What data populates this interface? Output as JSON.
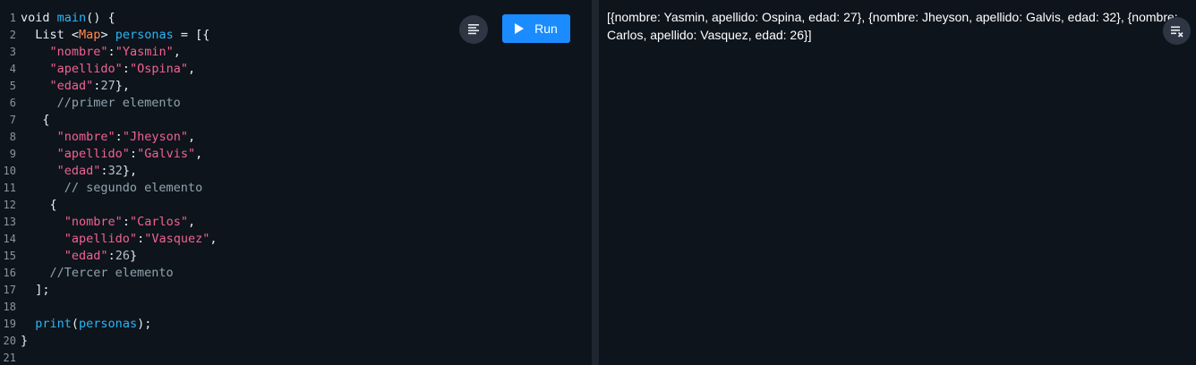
{
  "editor": {
    "line_numbers": [
      "1",
      "2",
      "3",
      "4",
      "5",
      "6",
      "7",
      "8",
      "9",
      "10",
      "11",
      "12",
      "13",
      "14",
      "15",
      "16",
      "17",
      "18",
      "19",
      "20",
      "21"
    ],
    "lines": [
      [
        {
          "t": "void ",
          "c": "kw"
        },
        {
          "t": "main",
          "c": "fn"
        },
        {
          "t": "() {",
          "c": "pl"
        }
      ],
      [
        {
          "t": "  List ",
          "c": "pl"
        },
        {
          "t": "<",
          "c": "pl"
        },
        {
          "t": "Map",
          "c": "ty"
        },
        {
          "t": "> ",
          "c": "pl"
        },
        {
          "t": "personas",
          "c": "fn"
        },
        {
          "t": " = [{",
          "c": "pl"
        }
      ],
      [
        {
          "t": "    ",
          "c": "pl"
        },
        {
          "t": "\"nombre\"",
          "c": "st"
        },
        {
          "t": ":",
          "c": "pl"
        },
        {
          "t": "\"Yasmin\"",
          "c": "st"
        },
        {
          "t": ",",
          "c": "pl"
        }
      ],
      [
        {
          "t": "    ",
          "c": "pl"
        },
        {
          "t": "\"apellido\"",
          "c": "st"
        },
        {
          "t": ":",
          "c": "pl"
        },
        {
          "t": "\"Ospina\"",
          "c": "st"
        },
        {
          "t": ",",
          "c": "pl"
        }
      ],
      [
        {
          "t": "    ",
          "c": "pl"
        },
        {
          "t": "\"edad\"",
          "c": "st"
        },
        {
          "t": ":",
          "c": "pl"
        },
        {
          "t": "27",
          "c": "nm"
        },
        {
          "t": "},",
          "c": "pl"
        }
      ],
      [
        {
          "t": "     //primer elemento",
          "c": "cm"
        }
      ],
      [
        {
          "t": "   {",
          "c": "pl"
        }
      ],
      [
        {
          "t": "     ",
          "c": "pl"
        },
        {
          "t": "\"nombre\"",
          "c": "st"
        },
        {
          "t": ":",
          "c": "pl"
        },
        {
          "t": "\"Jheyson\"",
          "c": "st"
        },
        {
          "t": ",",
          "c": "pl"
        }
      ],
      [
        {
          "t": "     ",
          "c": "pl"
        },
        {
          "t": "\"apellido\"",
          "c": "st"
        },
        {
          "t": ":",
          "c": "pl"
        },
        {
          "t": "\"Galvis\"",
          "c": "st"
        },
        {
          "t": ",",
          "c": "pl"
        }
      ],
      [
        {
          "t": "     ",
          "c": "pl"
        },
        {
          "t": "\"edad\"",
          "c": "st"
        },
        {
          "t": ":",
          "c": "pl"
        },
        {
          "t": "32",
          "c": "nm"
        },
        {
          "t": "},",
          "c": "pl"
        }
      ],
      [
        {
          "t": "      // segundo elemento",
          "c": "cm"
        }
      ],
      [
        {
          "t": "    {",
          "c": "pl"
        }
      ],
      [
        {
          "t": "      ",
          "c": "pl"
        },
        {
          "t": "\"nombre\"",
          "c": "st"
        },
        {
          "t": ":",
          "c": "pl"
        },
        {
          "t": "\"Carlos\"",
          "c": "st"
        },
        {
          "t": ",",
          "c": "pl"
        }
      ],
      [
        {
          "t": "      ",
          "c": "pl"
        },
        {
          "t": "\"apellido\"",
          "c": "st"
        },
        {
          "t": ":",
          "c": "pl"
        },
        {
          "t": "\"Vasquez\"",
          "c": "st"
        },
        {
          "t": ",",
          "c": "pl"
        }
      ],
      [
        {
          "t": "      ",
          "c": "pl"
        },
        {
          "t": "\"edad\"",
          "c": "st"
        },
        {
          "t": ":",
          "c": "pl"
        },
        {
          "t": "26",
          "c": "nm"
        },
        {
          "t": "}",
          "c": "pl"
        }
      ],
      [
        {
          "t": "    //Tercer elemento",
          "c": "cm"
        }
      ],
      [
        {
          "t": "  ];",
          "c": "pl"
        }
      ],
      [],
      [
        {
          "t": "  ",
          "c": "pl"
        },
        {
          "t": "print",
          "c": "fn"
        },
        {
          "t": "(",
          "c": "pl"
        },
        {
          "t": "personas",
          "c": "fn"
        },
        {
          "t": ");",
          "c": "pl"
        }
      ],
      [
        {
          "t": "}",
          "c": "pl"
        }
      ],
      []
    ]
  },
  "toolbar": {
    "run_label": "Run",
    "format_icon": "format-align-icon",
    "run_icon": "play-icon"
  },
  "output": {
    "text": "[{nombre: Yasmin, apellido: Ospina, edad: 27}, {nombre: Jheyson, apellido: Galvis, edad: 32}, {nombre: Carlos, apellido: Vasquez, edad: 26}]",
    "clear_icon": "clear-playlist-icon"
  },
  "colors": {
    "background": "#0e141c",
    "run_button": "#1a8cff",
    "string": "#f06292",
    "function": "#29b6f6",
    "type": "#ff8a50",
    "comment": "#90a4ae"
  }
}
